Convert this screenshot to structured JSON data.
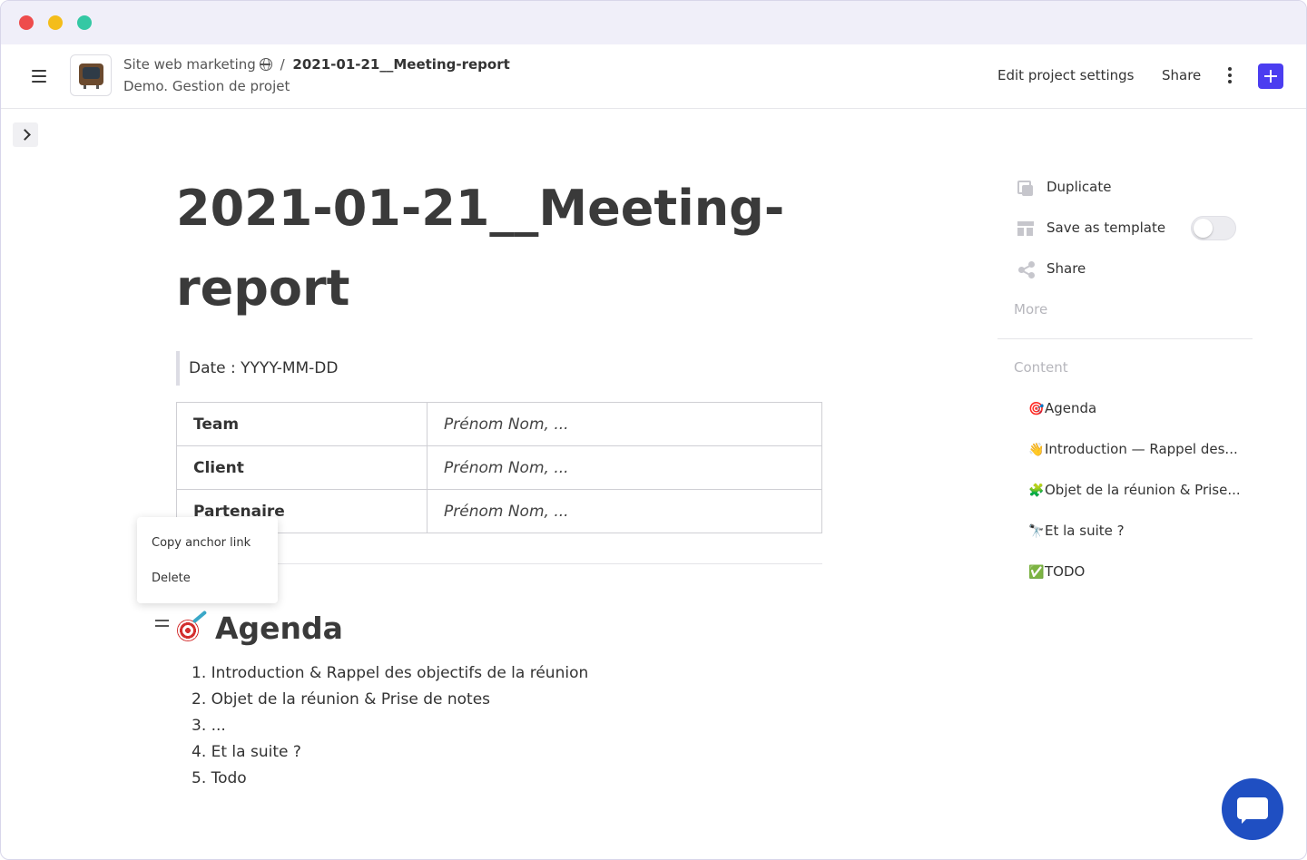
{
  "header": {
    "project_name": "Site web marketing",
    "separator": "/",
    "page_name": "2021-01-21__Meeting-report",
    "subtitle": "Demo. Gestion de projet",
    "edit_settings_label": "Edit project settings",
    "share_label": "Share"
  },
  "document": {
    "title": "2021-01-21__Meeting-report",
    "date_line": "Date : YYYY-MM-DD",
    "table": [
      {
        "key": "Team",
        "value": "Prénom Nom, ..."
      },
      {
        "key": "Client",
        "value": "Prénom Nom, ..."
      },
      {
        "key": "Partenaire",
        "value": "Prénom Nom, ..."
      }
    ],
    "agenda_heading": "Agenda",
    "agenda_items": [
      "1. Introduction & Rappel des objectifs de la réunion",
      "2. Objet de la réunion & Prise de notes",
      "3. ...",
      "4. Et la suite ?",
      "5. Todo"
    ]
  },
  "context_menu": {
    "items": [
      "Copy anchor link",
      "Delete"
    ]
  },
  "sidebar": {
    "actions": {
      "duplicate": "Duplicate",
      "save_template": "Save as template",
      "share": "Share",
      "more": "More"
    },
    "save_template_enabled": false,
    "content_heading": "Content",
    "toc": [
      {
        "emoji": "🎯",
        "label": "Agenda"
      },
      {
        "emoji": "👋",
        "label": "Introduction — Rappel des..."
      },
      {
        "emoji": "🧩",
        "label": "Objet de la réunion & Prise..."
      },
      {
        "emoji": "🔭",
        "label": "Et la suite ?"
      },
      {
        "emoji": "✅",
        "label": "TODO"
      }
    ]
  },
  "colors": {
    "accent": "#4b3df0",
    "chat": "#1f4fc2",
    "titlebar": "#f0eff9"
  }
}
